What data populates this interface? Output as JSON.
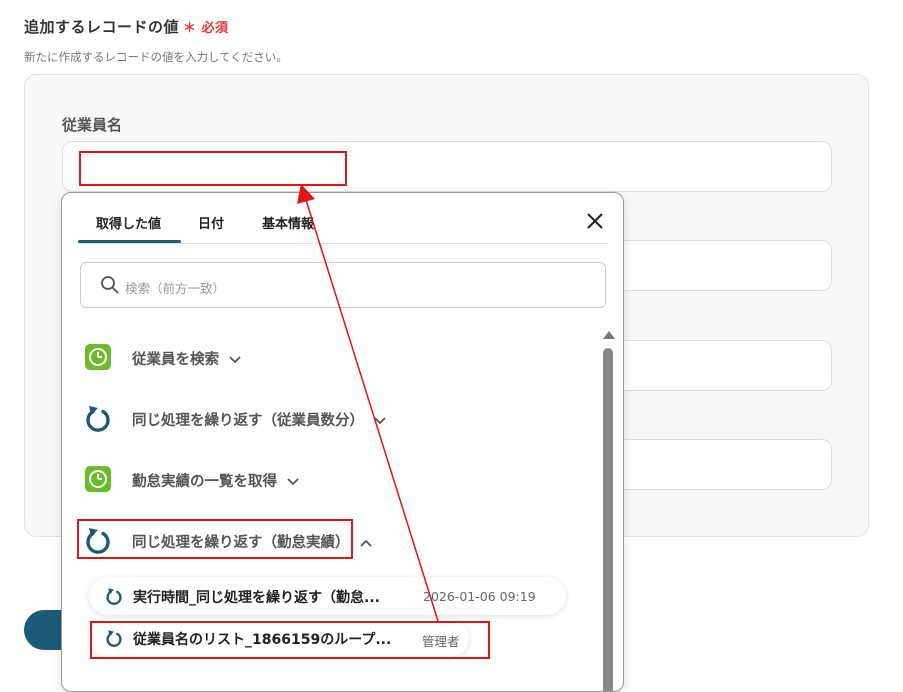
{
  "section": {
    "title": "追加するレコードの値",
    "required_label": "＊ 必須",
    "description": "新たに作成するレコードの値を入力してください。"
  },
  "form": {
    "field_label": "従業員名"
  },
  "picker": {
    "tabs": [
      {
        "label": "取得した値",
        "active": true
      },
      {
        "label": "日付",
        "active": false
      },
      {
        "label": "基本情報",
        "active": false
      }
    ],
    "search_placeholder": "検索（前方一致）",
    "groups": [
      {
        "label": "従業員を検索",
        "icon": "green-clock-icon",
        "expanded": false
      },
      {
        "label": "同じ処理を繰り返す（従業員数分）",
        "icon": "loop-icon",
        "expanded": false
      },
      {
        "label": "勤怠実績の一覧を取得",
        "icon": "green-clock-icon",
        "expanded": false
      },
      {
        "label": "同じ処理を繰り返す（勤怠実績）",
        "icon": "loop-icon",
        "expanded": true
      }
    ],
    "items": [
      {
        "label": "実行時間_同じ処理を繰り返す（勤怠...",
        "meta": "2026-01-06 09:19"
      },
      {
        "label": "従業員名のリスト_1866159のループ...",
        "meta": "管理者"
      }
    ]
  },
  "colors": {
    "accent": "#1a5b77",
    "highlight_red": "#e01515",
    "green_icon": "#6cbb2d"
  }
}
